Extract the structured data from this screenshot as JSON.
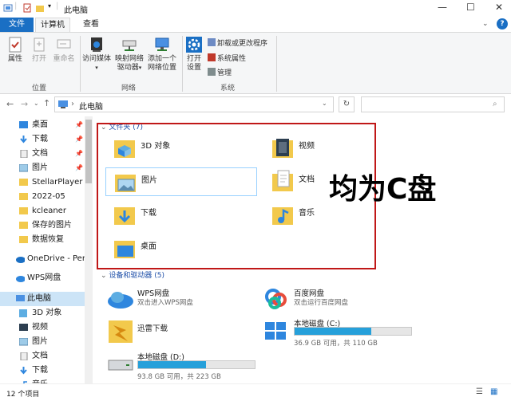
{
  "window": {
    "title": "此电脑"
  },
  "tabs": {
    "file": "文件",
    "computer": "计算机",
    "view": "查看"
  },
  "ribbon": {
    "location_group": "位置",
    "network_group": "网络",
    "system_group": "系统",
    "properties": "属性",
    "open": "打开",
    "rename": "重命名",
    "access_media": "访问媒体",
    "map_drive_1": "映射网络",
    "map_drive_2": "驱动器",
    "add_location_1": "添加一个",
    "add_location_2": "网络位置",
    "open_settings_1": "打开",
    "open_settings_2": "设置",
    "uninstall": "卸载或更改程序",
    "sys_props": "系统属性",
    "manage": "管理"
  },
  "address": {
    "path": "此电脑"
  },
  "nav": {
    "items": [
      {
        "label": "桌面",
        "pinned": true
      },
      {
        "label": "下载",
        "pinned": true
      },
      {
        "label": "文档",
        "pinned": true
      },
      {
        "label": "图片",
        "pinned": true
      },
      {
        "label": "StellarPlayer"
      },
      {
        "label": "2022-05"
      },
      {
        "label": "kcleaner"
      },
      {
        "label": "保存的图片"
      },
      {
        "label": "数据恢复"
      },
      {
        "label": "OneDrive - Perso"
      },
      {
        "label": "WPS网盘"
      },
      {
        "label": "此电脑"
      },
      {
        "label": "3D 对象"
      },
      {
        "label": "视频"
      },
      {
        "label": "图片"
      },
      {
        "label": "文档"
      },
      {
        "label": "下载"
      },
      {
        "label": "音乐"
      }
    ]
  },
  "content": {
    "folders_header": "文件夹 (7)",
    "folders": [
      "3D 对象",
      "视频",
      "图片",
      "文档",
      "下载",
      "音乐",
      "桌面"
    ],
    "devices_header": "设备和驱动器 (5)",
    "devices": {
      "wps": {
        "name": "WPS网盘",
        "desc": "双击进入WPS网盘"
      },
      "baidu": {
        "name": "百度网盘",
        "desc": "双击运行百度网盘"
      },
      "xunlei": {
        "name": "迅雷下载"
      },
      "c": {
        "name": "本地磁盘 (C:)",
        "desc": "36.9 GB 可用，共 110 GB",
        "used": 0.66
      },
      "d": {
        "name": "本地磁盘 (D:)",
        "desc": "93.8 GB 可用，共 223 GB",
        "used": 0.58
      }
    }
  },
  "annotation": "均为C盘",
  "status": {
    "count": "12 个项目"
  },
  "colors": {
    "accent": "#1a6fc4",
    "highlight": "#c01818",
    "drive_fill": "#26a0da"
  }
}
